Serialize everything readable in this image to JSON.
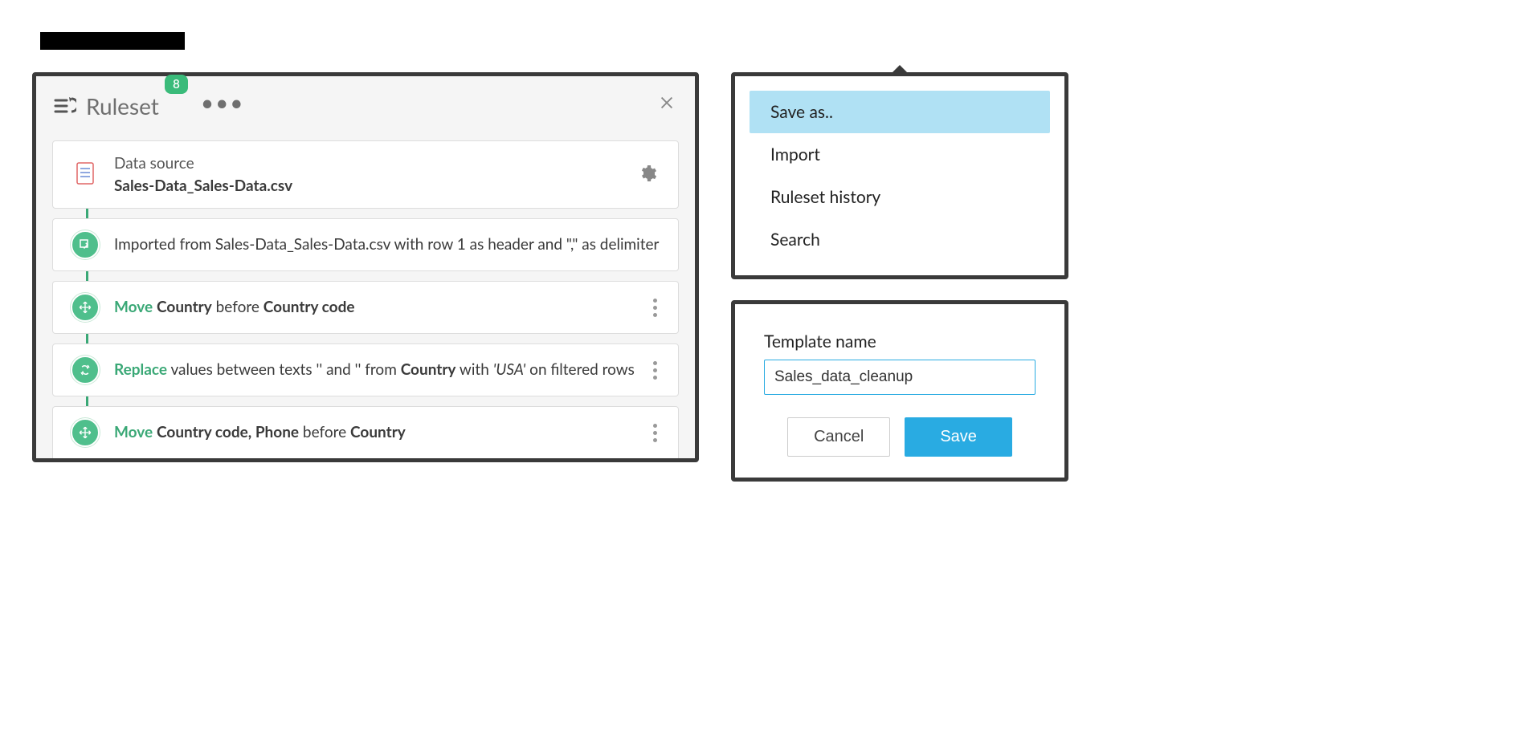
{
  "ruleset": {
    "title": "Ruleset",
    "badge": "8",
    "data_source": {
      "label": "Data source",
      "filename": "Sales-Data_Sales-Data.csv"
    },
    "steps": [
      {
        "type": "import",
        "text_parts": {
          "full": "Imported from Sales-Data_Sales-Data.csv with row 1 as header and \",\" as delimiter"
        }
      },
      {
        "type": "move",
        "action": "Move",
        "parts": {
          "p1": "Country",
          "mid": " before ",
          "p2": "Country code"
        }
      },
      {
        "type": "replace",
        "action": "Replace",
        "parts": {
          "t1": " values between texts '' and '' from ",
          "col": "Country",
          "t2": " with ",
          "val": "'USA'",
          "t3": " on filtered rows"
        }
      },
      {
        "type": "move",
        "action": "Move",
        "parts": {
          "p1": "Country code, Phone",
          "mid": " before ",
          "p2": "Country"
        }
      }
    ]
  },
  "menu": {
    "items": [
      {
        "label": "Save as..",
        "highlight": true
      },
      {
        "label": "Import",
        "highlight": false
      },
      {
        "label": "Ruleset history",
        "highlight": false
      },
      {
        "label": "Search",
        "highlight": false
      }
    ]
  },
  "dialog": {
    "field_label": "Template name",
    "value": "Sales_data_cleanup",
    "cancel": "Cancel",
    "save": "Save"
  }
}
